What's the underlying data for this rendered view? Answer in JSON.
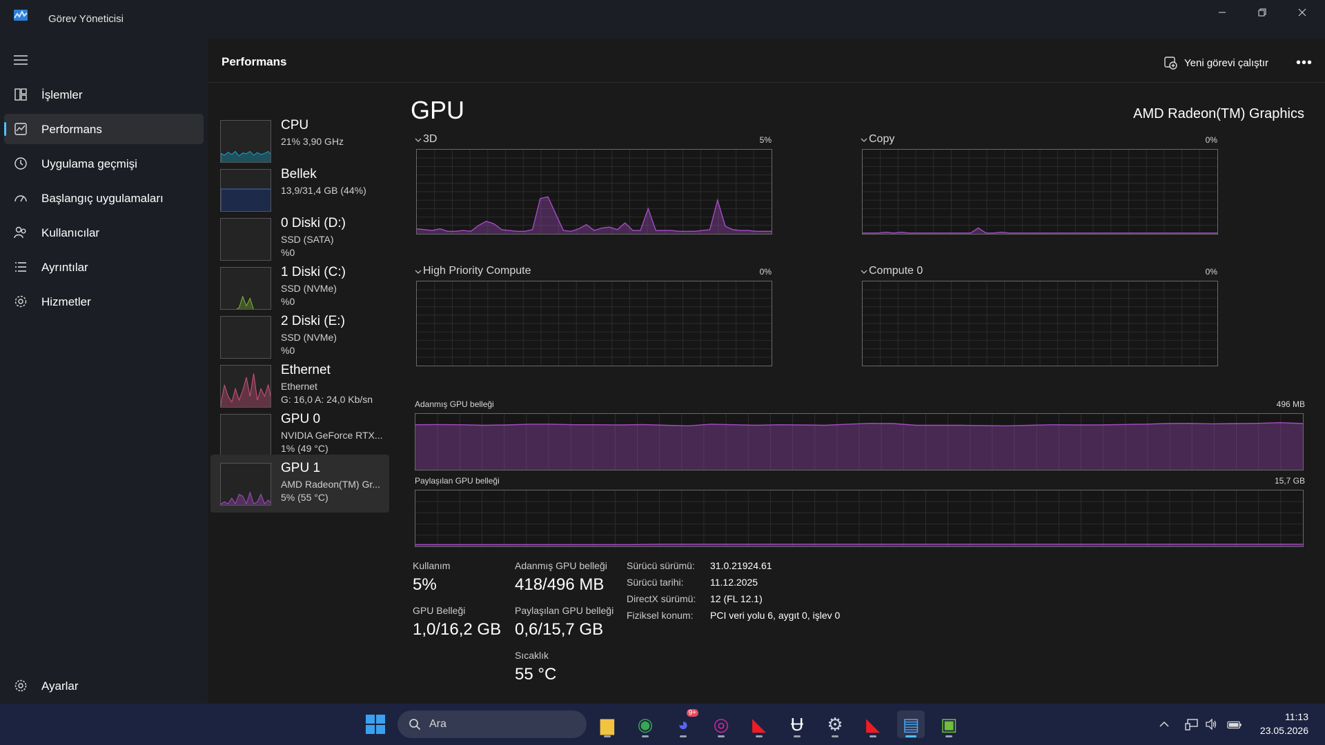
{
  "app": {
    "title": "Görev Yöneticisi"
  },
  "window": {
    "minimize": "—",
    "restore": "❐",
    "close": "✕"
  },
  "nav": {
    "items": [
      {
        "label": "İşlemler",
        "icon": "processes-icon"
      },
      {
        "label": "Performans",
        "icon": "performance-icon",
        "active": true
      },
      {
        "label": "Uygulama geçmişi",
        "icon": "history-icon"
      },
      {
        "label": "Başlangıç uygulamaları",
        "icon": "startup-icon"
      },
      {
        "label": "Kullanıcılar",
        "icon": "users-icon"
      },
      {
        "label": "Ayrıntılar",
        "icon": "details-icon"
      },
      {
        "label": "Hizmetler",
        "icon": "services-icon"
      }
    ],
    "settings": {
      "label": "Ayarlar",
      "icon": "settings-icon"
    }
  },
  "header": {
    "title": "Performans",
    "run_task": "Yeni görevi çalıştır",
    "more": "•••"
  },
  "devices": [
    {
      "name": "CPU",
      "line1": "21%  3,90 GHz",
      "line2": "",
      "color": "#17a2c8"
    },
    {
      "name": "Bellek",
      "line1": "13,9/31,4 GB (44%)",
      "line2": "",
      "color": "#3c6cc4"
    },
    {
      "name": "0 Diski (D:)",
      "line1": "SSD (SATA)",
      "line2": "%0",
      "color": "#7db33c"
    },
    {
      "name": "1 Diski (C:)",
      "line1": "SSD (NVMe)",
      "line2": "%0",
      "color": "#7db33c"
    },
    {
      "name": "2 Diski (E:)",
      "line1": "SSD (NVMe)",
      "line2": "%0",
      "color": "#7db33c"
    },
    {
      "name": "Ethernet",
      "line1": "Ethernet",
      "line2": "G: 16,0  A: 24,0 Kb/sn",
      "color": "#d2527f"
    },
    {
      "name": "GPU 0",
      "line1": "NVIDIA GeForce RTX...",
      "line2": "1%  (49 °C)",
      "color": "#a54cc4"
    },
    {
      "name": "GPU 1",
      "line1": "AMD Radeon(TM) Gr...",
      "line2": "5%  (55 °C)",
      "color": "#a54cc4",
      "selected": true
    }
  ],
  "gpu": {
    "title": "GPU",
    "model": "AMD Radeon(TM) Graphics",
    "engines": [
      {
        "label": "3D",
        "percent": "5%"
      },
      {
        "label": "Copy",
        "percent": "0%"
      },
      {
        "label": "High Priority Compute",
        "percent": "0%"
      },
      {
        "label": "Compute 0",
        "percent": "0%"
      }
    ],
    "dedicated_label": "Adanmış GPU belleği",
    "dedicated_max": "496 MB",
    "shared_label": "Paylaşılan GPU belleği",
    "shared_max": "15,7 GB"
  },
  "chart_data": [
    {
      "type": "area",
      "title": "3D",
      "ylim": [
        0,
        100
      ],
      "color": "#a54cc4",
      "values": [
        6,
        5,
        4,
        6,
        3,
        3,
        4,
        3,
        10,
        15,
        12,
        5,
        4,
        3,
        3,
        5,
        42,
        44,
        24,
        4,
        3,
        6,
        11,
        4,
        7,
        8,
        5,
        13,
        4,
        4,
        30,
        4,
        4,
        4,
        3,
        3,
        3,
        4,
        5,
        40,
        9,
        5,
        4,
        4,
        3,
        3,
        3
      ]
    },
    {
      "type": "area",
      "title": "Copy",
      "ylim": [
        0,
        100
      ],
      "color": "#a54cc4",
      "values": [
        1,
        1,
        1,
        2,
        1,
        2,
        1,
        1,
        1,
        1,
        1,
        1,
        1,
        1,
        1,
        7,
        1,
        1,
        2,
        1,
        1,
        1,
        1,
        1,
        1,
        1,
        1,
        1,
        1,
        1,
        1,
        1,
        1,
        1,
        1,
        1,
        1,
        1,
        1,
        1,
        1,
        1,
        1,
        1,
        1,
        1,
        1
      ]
    },
    {
      "type": "area",
      "title": "High Priority Compute",
      "ylim": [
        0,
        100
      ],
      "values": []
    },
    {
      "type": "area",
      "title": "Compute 0",
      "ylim": [
        0,
        100
      ],
      "values": []
    },
    {
      "type": "area",
      "title": "Adanmış GPU belleği",
      "ylim": [
        0,
        496
      ],
      "unit": "MB",
      "color": "#a54cc4",
      "values": [
        400,
        402,
        400,
        395,
        398,
        405,
        405,
        400,
        400,
        398,
        402,
        395,
        390,
        405,
        400,
        395,
        400,
        398,
        395,
        405,
        412,
        410,
        395,
        395,
        395,
        392,
        390,
        395,
        400,
        398,
        398,
        402,
        405,
        410,
        412,
        408,
        410,
        412,
        418,
        410
      ]
    },
    {
      "type": "area",
      "title": "Paylaşılan GPU belleği",
      "ylim": [
        0,
        15.7
      ],
      "unit": "GB",
      "color": "#a54cc4",
      "values": [
        0.5,
        0.5,
        0.5,
        0.5,
        0.5,
        0.5,
        0.5,
        0.5,
        0.6,
        0.6,
        0.6,
        0.6,
        0.6,
        0.6,
        0.6,
        0.6,
        0.6,
        0.6,
        0.6,
        0.6,
        0.6,
        0.6,
        0.6,
        0.6,
        0.6,
        0.6,
        0.6,
        0.6,
        0.6,
        0.6
      ]
    }
  ],
  "stats": {
    "utilization_label": "Kullanım",
    "utilization": "5%",
    "dedicated_label": "Adanmış GPU belleği",
    "dedicated": "418/496 MB",
    "gpu_memory_label": "GPU Belleği",
    "gpu_memory": "1,0/16,2 GB",
    "shared_label": "Paylaşılan GPU belleği",
    "shared": "0,6/15,7 GB",
    "temp_label": "Sıcaklık",
    "temp": "55 °C"
  },
  "info": [
    {
      "key": "Sürücü sürümü:",
      "value": "31.0.21924.61"
    },
    {
      "key": "Sürücü tarihi:",
      "value": "11.12.2025"
    },
    {
      "key": "DirectX sürümü:",
      "value": "12 (FL 12.1)"
    },
    {
      "key": "Fiziksel konum:",
      "value": "PCI veri yolu 6, aygıt 0, işlev 0"
    }
  ],
  "taskbar": {
    "search_placeholder": "Ara",
    "apps": [
      "file-explorer-icon",
      "chrome-icon",
      "discord-icon",
      "instagram-icon",
      "amd-software-icon",
      "unreal-engine-icon",
      "steam-icon",
      "amd-adrenalin-icon",
      "task-manager-icon",
      "gpu-z-icon"
    ],
    "discord_badge": "9+",
    "time": "11:13",
    "date": "23.05.2026"
  }
}
